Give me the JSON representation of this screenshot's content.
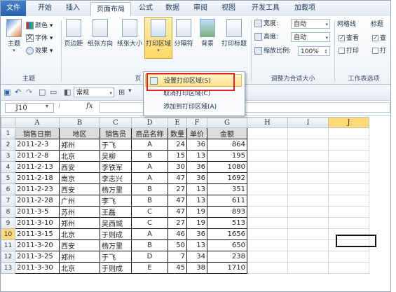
{
  "tabs": [
    "文件",
    "开始",
    "插入",
    "页面布局",
    "公式",
    "数据",
    "审阅",
    "视图",
    "开发工具",
    "加载项"
  ],
  "active_tab": "页面布局",
  "ribbon": {
    "theme_group": {
      "label": "主题",
      "theme_button": "主题",
      "colors": "颜色",
      "fonts": "字体",
      "effects": "效果"
    },
    "page_setup": {
      "margins": "页边距",
      "orientation": "纸张方向",
      "size": "纸张大小",
      "print_area": "打印区域",
      "breaks": "分隔符",
      "background": "背景",
      "print_titles": "打印标题",
      "label": "页"
    },
    "scale_group": {
      "label": "调整为合适大小",
      "width_label": "宽度:",
      "width_value": "自动",
      "height_label": "高度:",
      "height_value": "自动",
      "scale_label": "缩放比例:",
      "scale_value": "100%"
    },
    "sheet_options": {
      "label": "工作表选项",
      "gridlines": "网格线",
      "headings": "标题",
      "view": "查看",
      "view2": "查",
      "print": "打印",
      "print2": "打"
    }
  },
  "print_area_menu": {
    "set": "设置打印区域(S)",
    "clear": "取消打印区域(C)",
    "add": "添加到打印区域(A)"
  },
  "qat": {
    "style_label": "常规"
  },
  "formula_bar": {
    "name_box": "J10",
    "fx": "fx"
  },
  "columns": [
    "A",
    "B",
    "C",
    "D",
    "E",
    "F",
    "G",
    "H",
    "I",
    "J"
  ],
  "rows": [
    "1",
    "2",
    "3",
    "4",
    "5",
    "6",
    "7",
    "8",
    "9",
    "10",
    "11",
    "12",
    "13"
  ],
  "selected_cell": "J10",
  "table": {
    "headers": [
      "销售日期",
      "地区",
      "销售员",
      "商品名称",
      "数量",
      "单价",
      "金额"
    ],
    "rows": [
      [
        "2011-2-3",
        "郑州",
        "于飞",
        "A",
        "24",
        "36",
        "864"
      ],
      [
        "2011-2-8",
        "北京",
        "吴柳",
        "B",
        "15",
        "13",
        "195"
      ],
      [
        "2011-2-13",
        "西安",
        "李铁军",
        "A",
        "30",
        "36",
        "1080"
      ],
      [
        "2011-2-18",
        "南京",
        "李志兴",
        "A",
        "47",
        "36",
        "1692"
      ],
      [
        "2011-2-23",
        "西安",
        "杨万里",
        "B",
        "27",
        "13",
        "351"
      ],
      [
        "2011-2-28",
        "广州",
        "李飞",
        "B",
        "47",
        "13",
        "611"
      ],
      [
        "2011-3-5",
        "苏州",
        "王磊",
        "C",
        "47",
        "19",
        "893"
      ],
      [
        "2011-3-10",
        "郑州",
        "吴西城",
        "C",
        "27",
        "19",
        "513"
      ],
      [
        "2011-3-15",
        "北京",
        "于则成",
        "A",
        "46",
        "36",
        "1656"
      ],
      [
        "2011-3-20",
        "西安",
        "杨万里",
        "B",
        "50",
        "13",
        "650"
      ],
      [
        "2011-3-25",
        "郑州",
        "于飞",
        "D",
        "7",
        "34",
        "238"
      ],
      [
        "2011-3-30",
        "北京",
        "于则成",
        "E",
        "45",
        "38",
        "1710"
      ]
    ]
  },
  "colors": {
    "file_tab": "#2a62ab",
    "highlight": "#ffd865",
    "red_box": "#e0202a",
    "selected_header": "#ffd97a"
  }
}
